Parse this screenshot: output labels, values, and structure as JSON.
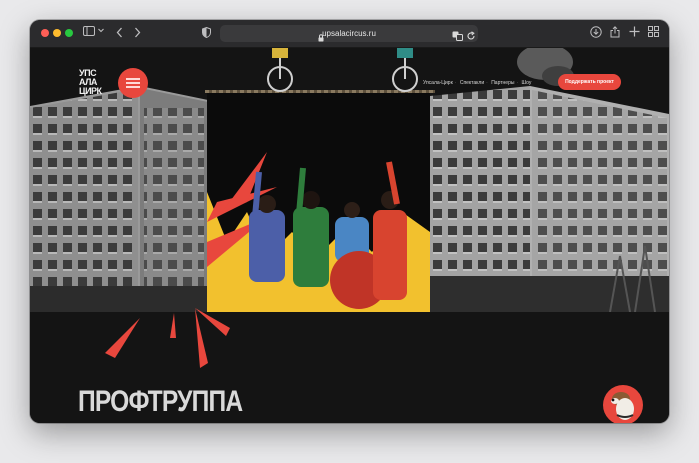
{
  "browser": {
    "url": "upsalacircus.ru",
    "icons": [
      "sidebar-icon",
      "chevron-down-icon",
      "back-icon",
      "forward-icon",
      "shield-icon",
      "lock-icon",
      "translate-icon",
      "reload-icon",
      "download-icon",
      "share-icon",
      "new-tab-icon",
      "tab-overview-icon"
    ]
  },
  "site": {
    "logo_lines": [
      "УПС",
      "АЛА",
      "ЦИРК"
    ],
    "nav": [
      "Упсала-Цирк",
      "Спектакли",
      "Партнеры",
      "Шоу"
    ],
    "support_label": "Поддержать проект",
    "heading": "ПРОФТРУППА"
  },
  "colors": {
    "accent": "#e8473d",
    "background": "#141414",
    "yellow": "#f5c518"
  }
}
